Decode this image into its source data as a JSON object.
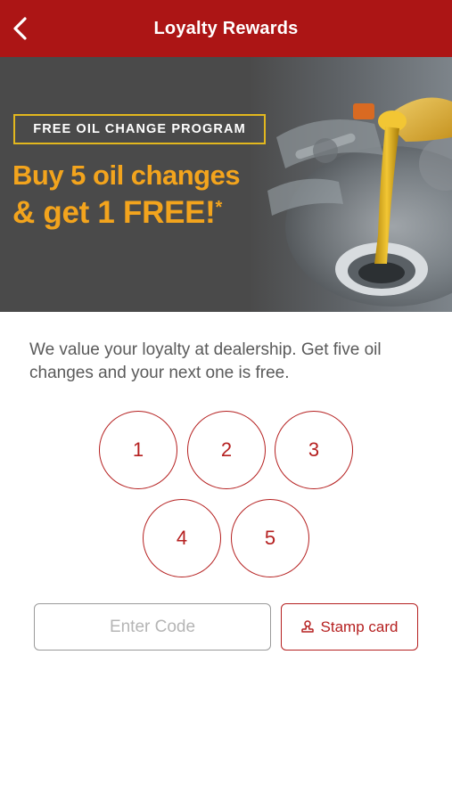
{
  "header": {
    "title": "Loyalty Rewards",
    "back_icon": "chevron-left-icon",
    "bg_color": "#ac1515"
  },
  "banner": {
    "program_label": "FREE OIL CHANGE PROGRAM",
    "headline_line1": "Buy 5 oil changes",
    "headline_line2": "& get 1 FREE!",
    "headline_mark": "*",
    "headline_color": "#f3a41d"
  },
  "description": "We value your loyalty at dealership. Get five oil changes and your next one is free.",
  "stamps": [
    "1",
    "2",
    "3",
    "4",
    "5"
  ],
  "code_input": {
    "placeholder": "Enter Code",
    "value": ""
  },
  "stamp_button": {
    "label": "Stamp card",
    "icon": "stamp-icon"
  },
  "accent_color": "#b52020"
}
